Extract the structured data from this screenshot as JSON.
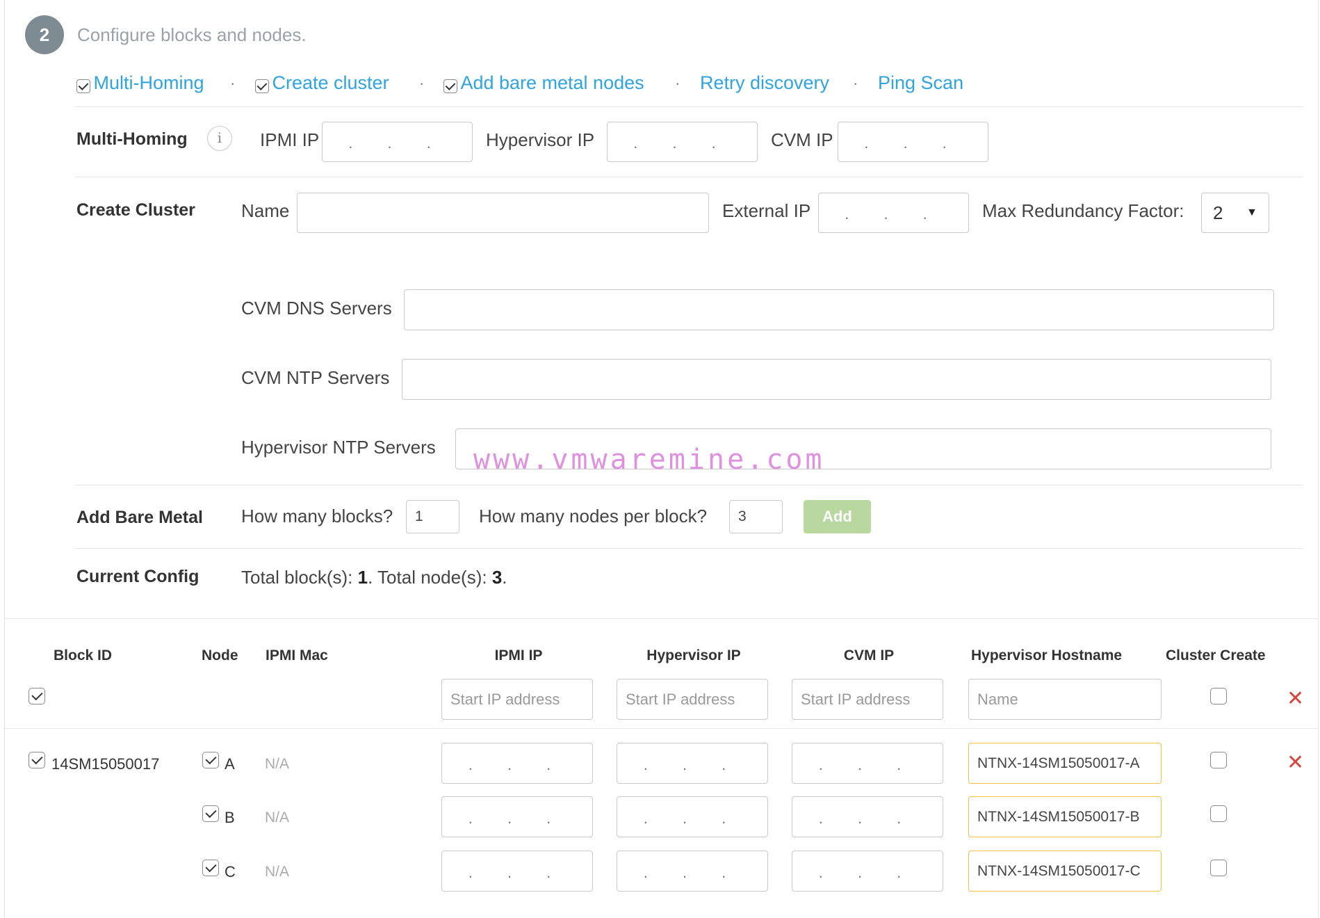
{
  "step": {
    "number": "2",
    "title": "Configure blocks and nodes."
  },
  "top_links": [
    {
      "label": "Multi-Homing",
      "checkbox": true,
      "checked": true
    },
    {
      "label": "Create cluster",
      "checkbox": true,
      "checked": true
    },
    {
      "label": "Add bare metal nodes",
      "checkbox": true,
      "checked": true
    },
    {
      "label": "Retry discovery",
      "checkbox": false
    },
    {
      "label": "Ping Scan",
      "checkbox": false
    }
  ],
  "link_separator": "·",
  "multi_homing": {
    "label": "Multi-Homing",
    "info_icon": "i",
    "ipmi_ip_label": "IPMI IP",
    "hypervisor_ip_label": "Hypervisor IP",
    "cvm_ip_label": "CVM IP",
    "ip_placeholder": ". . ."
  },
  "create_cluster": {
    "label": "Create Cluster",
    "name_label": "Name",
    "name_value": "",
    "external_ip_label": "External IP",
    "external_ip_placeholder": ". . .",
    "max_redundancy_label": "Max Redundancy Factor:",
    "max_redundancy_value": "2",
    "cvm_dns_label": "CVM DNS Servers",
    "cvm_dns_value": "",
    "cvm_ntp_label": "CVM NTP Servers",
    "cvm_ntp_value": "",
    "hypervisor_ntp_label": "Hypervisor NTP Servers",
    "hypervisor_ntp_value": ""
  },
  "watermark": "www.vmwaremine.com",
  "add_bare_metal": {
    "label": "Add Bare Metal",
    "blocks_label": "How many blocks?",
    "blocks_value": "1",
    "nodes_label": "How many nodes per block?",
    "nodes_value": "3",
    "add_button": "Add"
  },
  "current_config": {
    "label": "Current Config",
    "text_a": "Total block(s): ",
    "blocks": "1",
    "text_b": ". Total node(s): ",
    "nodes": "3",
    "text_c": "."
  },
  "table": {
    "headers": {
      "block_id": "Block ID",
      "node": "Node",
      "ipmi_mac": "IPMI Mac",
      "ipmi_ip": "IPMI IP",
      "hypervisor_ip": "Hypervisor IP",
      "cvm_ip": "CVM IP",
      "hypervisor_hostname": "Hypervisor Hostname",
      "cluster_create": "Cluster Create"
    },
    "filter_row": {
      "select_all_checked": true,
      "ipmi_ip_placeholder": "Start IP address",
      "hypervisor_ip_placeholder": "Start IP address",
      "cvm_ip_placeholder": "Start IP address",
      "hostname_placeholder": "Name",
      "cluster_create_checked": false
    },
    "block": {
      "id": "14SM15050017",
      "checked": true
    },
    "rows": [
      {
        "node": "A",
        "ipmi_mac": "N/A",
        "ip_placeholder": ". . .",
        "hostname": "NTNX-14SM15050017-A",
        "node_checked": true,
        "cluster_create_checked": false
      },
      {
        "node": "B",
        "ipmi_mac": "N/A",
        "ip_placeholder": ". . .",
        "hostname": "NTNX-14SM15050017-B",
        "node_checked": true,
        "cluster_create_checked": false
      },
      {
        "node": "C",
        "ipmi_mac": "N/A",
        "ip_placeholder": ". . .",
        "hostname": "NTNX-14SM15050017-C",
        "node_checked": true,
        "cluster_create_checked": false
      }
    ],
    "delete_icon": "✕"
  },
  "colors": {
    "link": "#2ea4e3",
    "step_circle": "#7f8b93",
    "add_button": "#b8d8a0",
    "hostname_border": "#f5c242",
    "delete": "#d9453d",
    "watermark": "#e090e0"
  }
}
